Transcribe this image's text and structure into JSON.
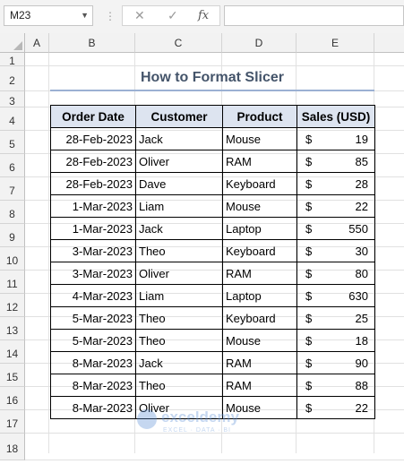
{
  "formula_bar": {
    "name_box": "M23",
    "fx_label": "fx",
    "cancel_icon": "✕",
    "enter_icon": "✓"
  },
  "columns": [
    "A",
    "B",
    "C",
    "D",
    "E"
  ],
  "rows": [
    "1",
    "2",
    "3",
    "4",
    "5",
    "6",
    "7",
    "8",
    "9",
    "10",
    "11",
    "12",
    "13",
    "14",
    "15",
    "16",
    "17",
    "18"
  ],
  "title": "How to Format Slicer",
  "table": {
    "headers": [
      "Order Date",
      "Customer",
      "Product",
      "Sales (USD)"
    ],
    "currency_symbol": "$",
    "rows": [
      {
        "date": "28-Feb-2023",
        "customer": "Jack",
        "product": "Mouse",
        "sales": "19"
      },
      {
        "date": "28-Feb-2023",
        "customer": "Oliver",
        "product": "RAM",
        "sales": "85"
      },
      {
        "date": "28-Feb-2023",
        "customer": "Dave",
        "product": "Keyboard",
        "sales": "28"
      },
      {
        "date": "1-Mar-2023",
        "customer": "Liam",
        "product": "Mouse",
        "sales": "22"
      },
      {
        "date": "1-Mar-2023",
        "customer": "Jack",
        "product": "Laptop",
        "sales": "550"
      },
      {
        "date": "3-Mar-2023",
        "customer": "Theo",
        "product": "Keyboard",
        "sales": "30"
      },
      {
        "date": "3-Mar-2023",
        "customer": "Oliver",
        "product": "RAM",
        "sales": "80"
      },
      {
        "date": "4-Mar-2023",
        "customer": "Liam",
        "product": "Laptop",
        "sales": "630"
      },
      {
        "date": "5-Mar-2023",
        "customer": "Theo",
        "product": "Keyboard",
        "sales": "25"
      },
      {
        "date": "5-Mar-2023",
        "customer": "Theo",
        "product": "Mouse",
        "sales": "18"
      },
      {
        "date": "8-Mar-2023",
        "customer": "Jack",
        "product": "RAM",
        "sales": "90"
      },
      {
        "date": "8-Mar-2023",
        "customer": "Theo",
        "product": "RAM",
        "sales": "88"
      },
      {
        "date": "8-Mar-2023",
        "customer": "Oliver",
        "product": "Mouse",
        "sales": "22"
      }
    ]
  },
  "watermark": {
    "name": "exceldemy",
    "tagline": "EXCEL · DATA · BI"
  },
  "colors": {
    "header_fill": "#dde4f0",
    "title": "#44546a",
    "title_rule": "#9bb0d3"
  }
}
